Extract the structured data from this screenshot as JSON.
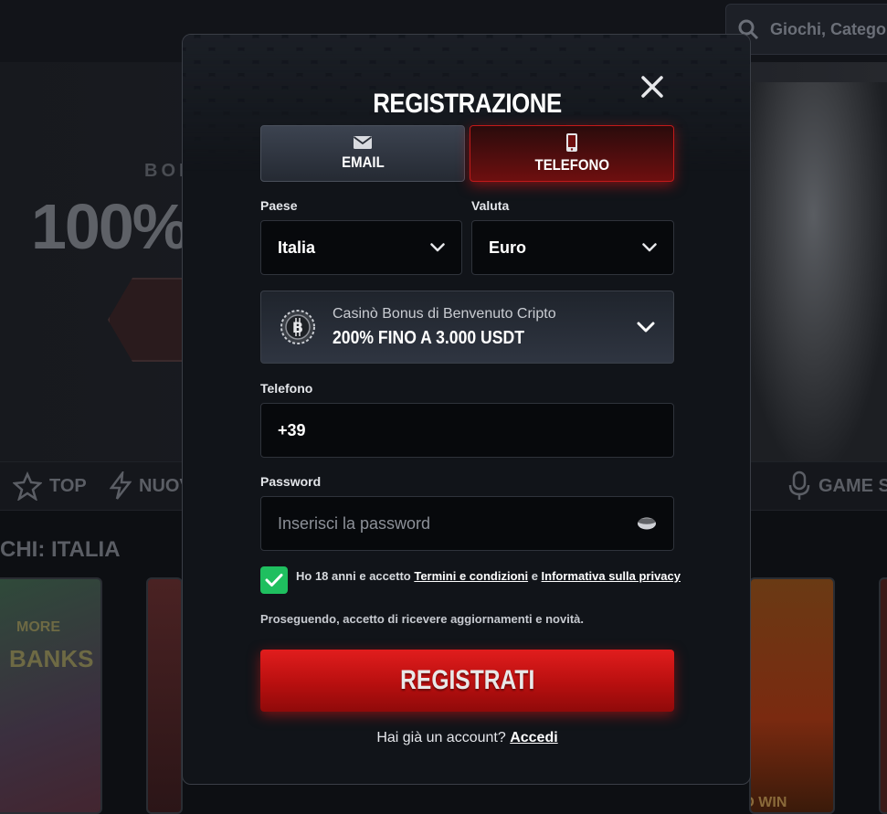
{
  "background": {
    "search_placeholder": "Giochi, Categor",
    "bonus_small": "BON",
    "bonus_big": "100%",
    "categories": [
      {
        "label": "TOP"
      },
      {
        "label": "NUOVO"
      },
      {
        "label": "GAME SHO"
      }
    ],
    "section_title": "CHI: ITALIA",
    "card_texts": [
      "MORE",
      "BANKS",
      "HOLD AND WIN"
    ]
  },
  "modal": {
    "title": "REGISTRAZIONE",
    "tabs": {
      "email": "EMAIL",
      "phone": "TELEFONO",
      "active": "phone"
    },
    "country": {
      "label": "Paese",
      "value": "Italia"
    },
    "currency": {
      "label": "Valuta",
      "value": "Euro"
    },
    "bonus": {
      "subtitle": "Casinò Bonus di Benvenuto Cripto",
      "title": "200% FINO A 3.000 USDT"
    },
    "phone": {
      "label": "Telefono",
      "value": "+39"
    },
    "password": {
      "label": "Password",
      "placeholder": "Inserisci la password"
    },
    "terms": {
      "checked": true,
      "prefix": "Ho 18 anni e accetto",
      "terms_link": "Termini e condizioni",
      "conjunction": "e",
      "privacy_link": "Informativa sulla privacy"
    },
    "notice": "Proseguendo, accetto di ricevere aggiornamenti e novità.",
    "register_button": "REGISTRATI",
    "login": {
      "prompt": "Hai già un account?",
      "link": "Accedi"
    }
  },
  "colors": {
    "accent_red": "#c21a1a",
    "checkbox_green": "#1fbf5f",
    "modal_bg": "#111419"
  }
}
